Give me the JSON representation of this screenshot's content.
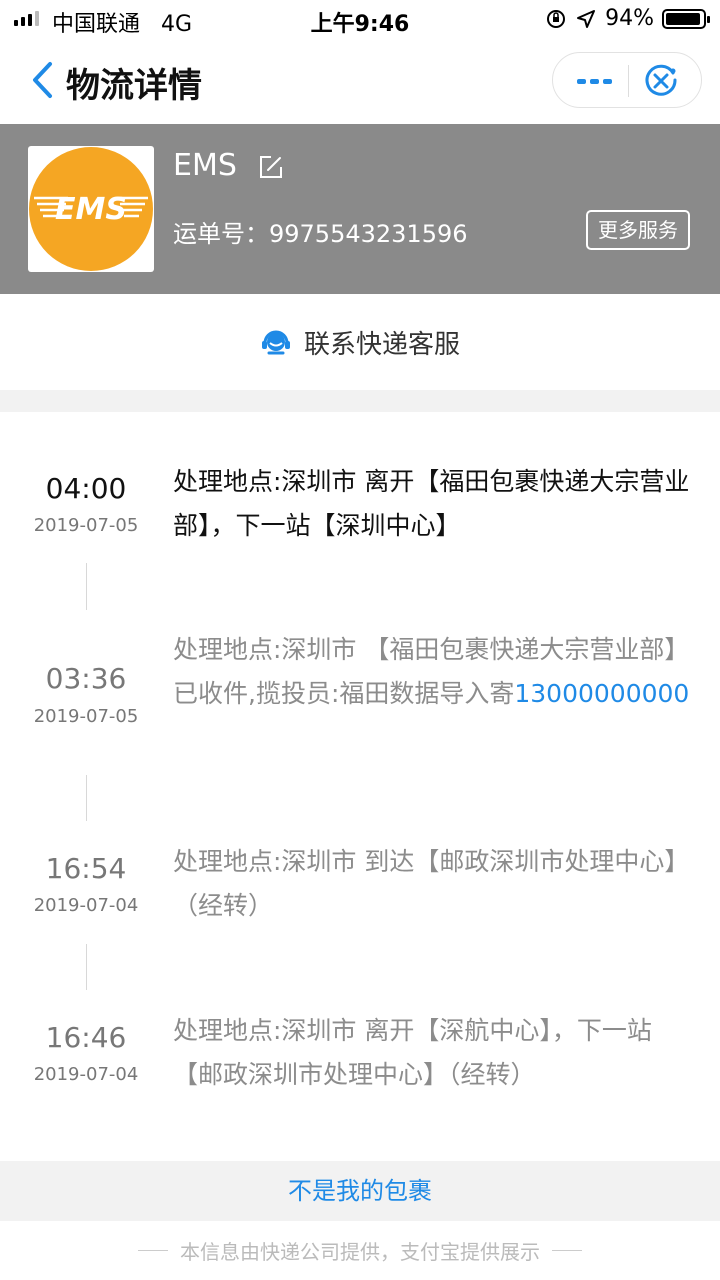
{
  "status_bar": {
    "carrier": "中国联通",
    "network": "4G",
    "time": "上午9:46",
    "battery_percent": "94%",
    "battery_level": 0.94
  },
  "nav": {
    "title": "物流详情"
  },
  "header": {
    "company": "EMS",
    "logo_text": "EMS",
    "waybill_label": "运单号：",
    "waybill_number": "9975543231596",
    "more_services": "更多服务",
    "colors": {
      "background": "#8a8a8a",
      "logo": "#f5a623"
    }
  },
  "contact": {
    "label": "联系快递客服"
  },
  "timeline": [
    {
      "time": "04:00",
      "date": "2019-07-05",
      "text": "处理地点:深圳市 离开【福田包裹快递大宗营业部】，下一站【深圳中心】",
      "phone": ""
    },
    {
      "time": "03:36",
      "date": "2019-07-05",
      "text": "处理地点:深圳市 【福田包裹快递大宗营业部】已收件,揽投员:福田数据导入寄",
      "phone": "13000000000"
    },
    {
      "time": "16:54",
      "date": "2019-07-04",
      "text": "处理地点:深圳市 到达【邮政深圳市处理中心】（经转）",
      "phone": ""
    },
    {
      "time": "16:46",
      "date": "2019-07-04",
      "text": "处理地点:深圳市 离开【深航中心】，下一站【邮政深圳市处理中心】（经转）",
      "phone": ""
    }
  ],
  "bottom": {
    "not_mine": "不是我的包裹",
    "footer": "本信息由快递公司提供，支付宝提供展示"
  },
  "colors": {
    "accent": "#1f8ae6"
  }
}
